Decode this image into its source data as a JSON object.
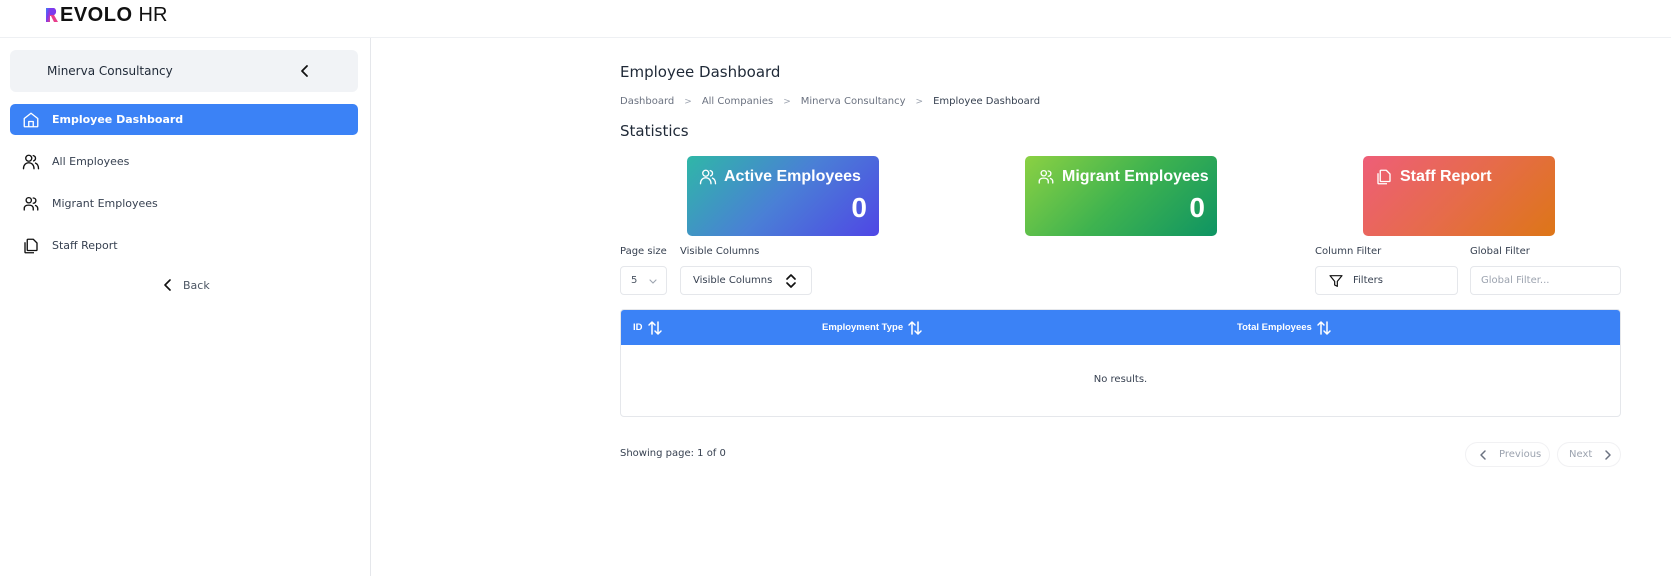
{
  "app": {
    "logo_text": "EVOLO",
    "logo_suffix": "HR",
    "logo_mark_colors": [
      "#e83e8c",
      "#6f42c1",
      "#3b82f6"
    ]
  },
  "sidebar": {
    "company_name": "Minerva Consultancy",
    "items": [
      {
        "label": "Employee Dashboard",
        "icon": "home-icon",
        "active": true
      },
      {
        "label": "All Employees",
        "icon": "users-icon",
        "active": false
      },
      {
        "label": "Migrant Employees",
        "icon": "users-group-icon",
        "active": false
      },
      {
        "label": "Staff Report",
        "icon": "copy-document-icon",
        "active": false
      }
    ],
    "back_label": "Back"
  },
  "main": {
    "title": "Employee Dashboard",
    "breadcrumb": [
      "Dashboard",
      "All Companies",
      "Minerva Consultancy",
      "Employee Dashboard"
    ],
    "section_title": "Statistics",
    "stats": [
      {
        "label": "Active Employees",
        "value": "0",
        "icon": "users-icon",
        "colors": [
          "#2fb7a7",
          "#4f46e5"
        ]
      },
      {
        "label": "Migrant Employees",
        "value": "0",
        "icon": "users-group-icon",
        "colors": [
          "#8bd143",
          "#0e9463"
        ]
      },
      {
        "label": "Staff Report",
        "value": "",
        "icon": "copy-document-icon",
        "colors": [
          "#ee5e78",
          "#dd7617"
        ]
      }
    ],
    "controls": {
      "page_size_label": "Page size",
      "page_size_value": "5",
      "visible_columns_label": "Visible Columns",
      "visible_columns_value": "Visible Columns",
      "column_filter_label": "Column Filter",
      "column_filter_value": "Filters",
      "global_filter_label": "Global Filter",
      "global_filter_placeholder": "Global Filter...",
      "global_filter_value": ""
    },
    "table": {
      "header_color": "#3b82f6",
      "columns": [
        "ID",
        "Employment Type",
        "Total Employees"
      ],
      "rows": [],
      "empty_message": "No results."
    },
    "pagination": {
      "info": "Showing page: 1 of 0",
      "previous_label": "Previous",
      "next_label": "Next"
    }
  },
  "colors": {
    "accent": "#3b82f6",
    "sidebar_card_bg": "#f1f3f6"
  }
}
